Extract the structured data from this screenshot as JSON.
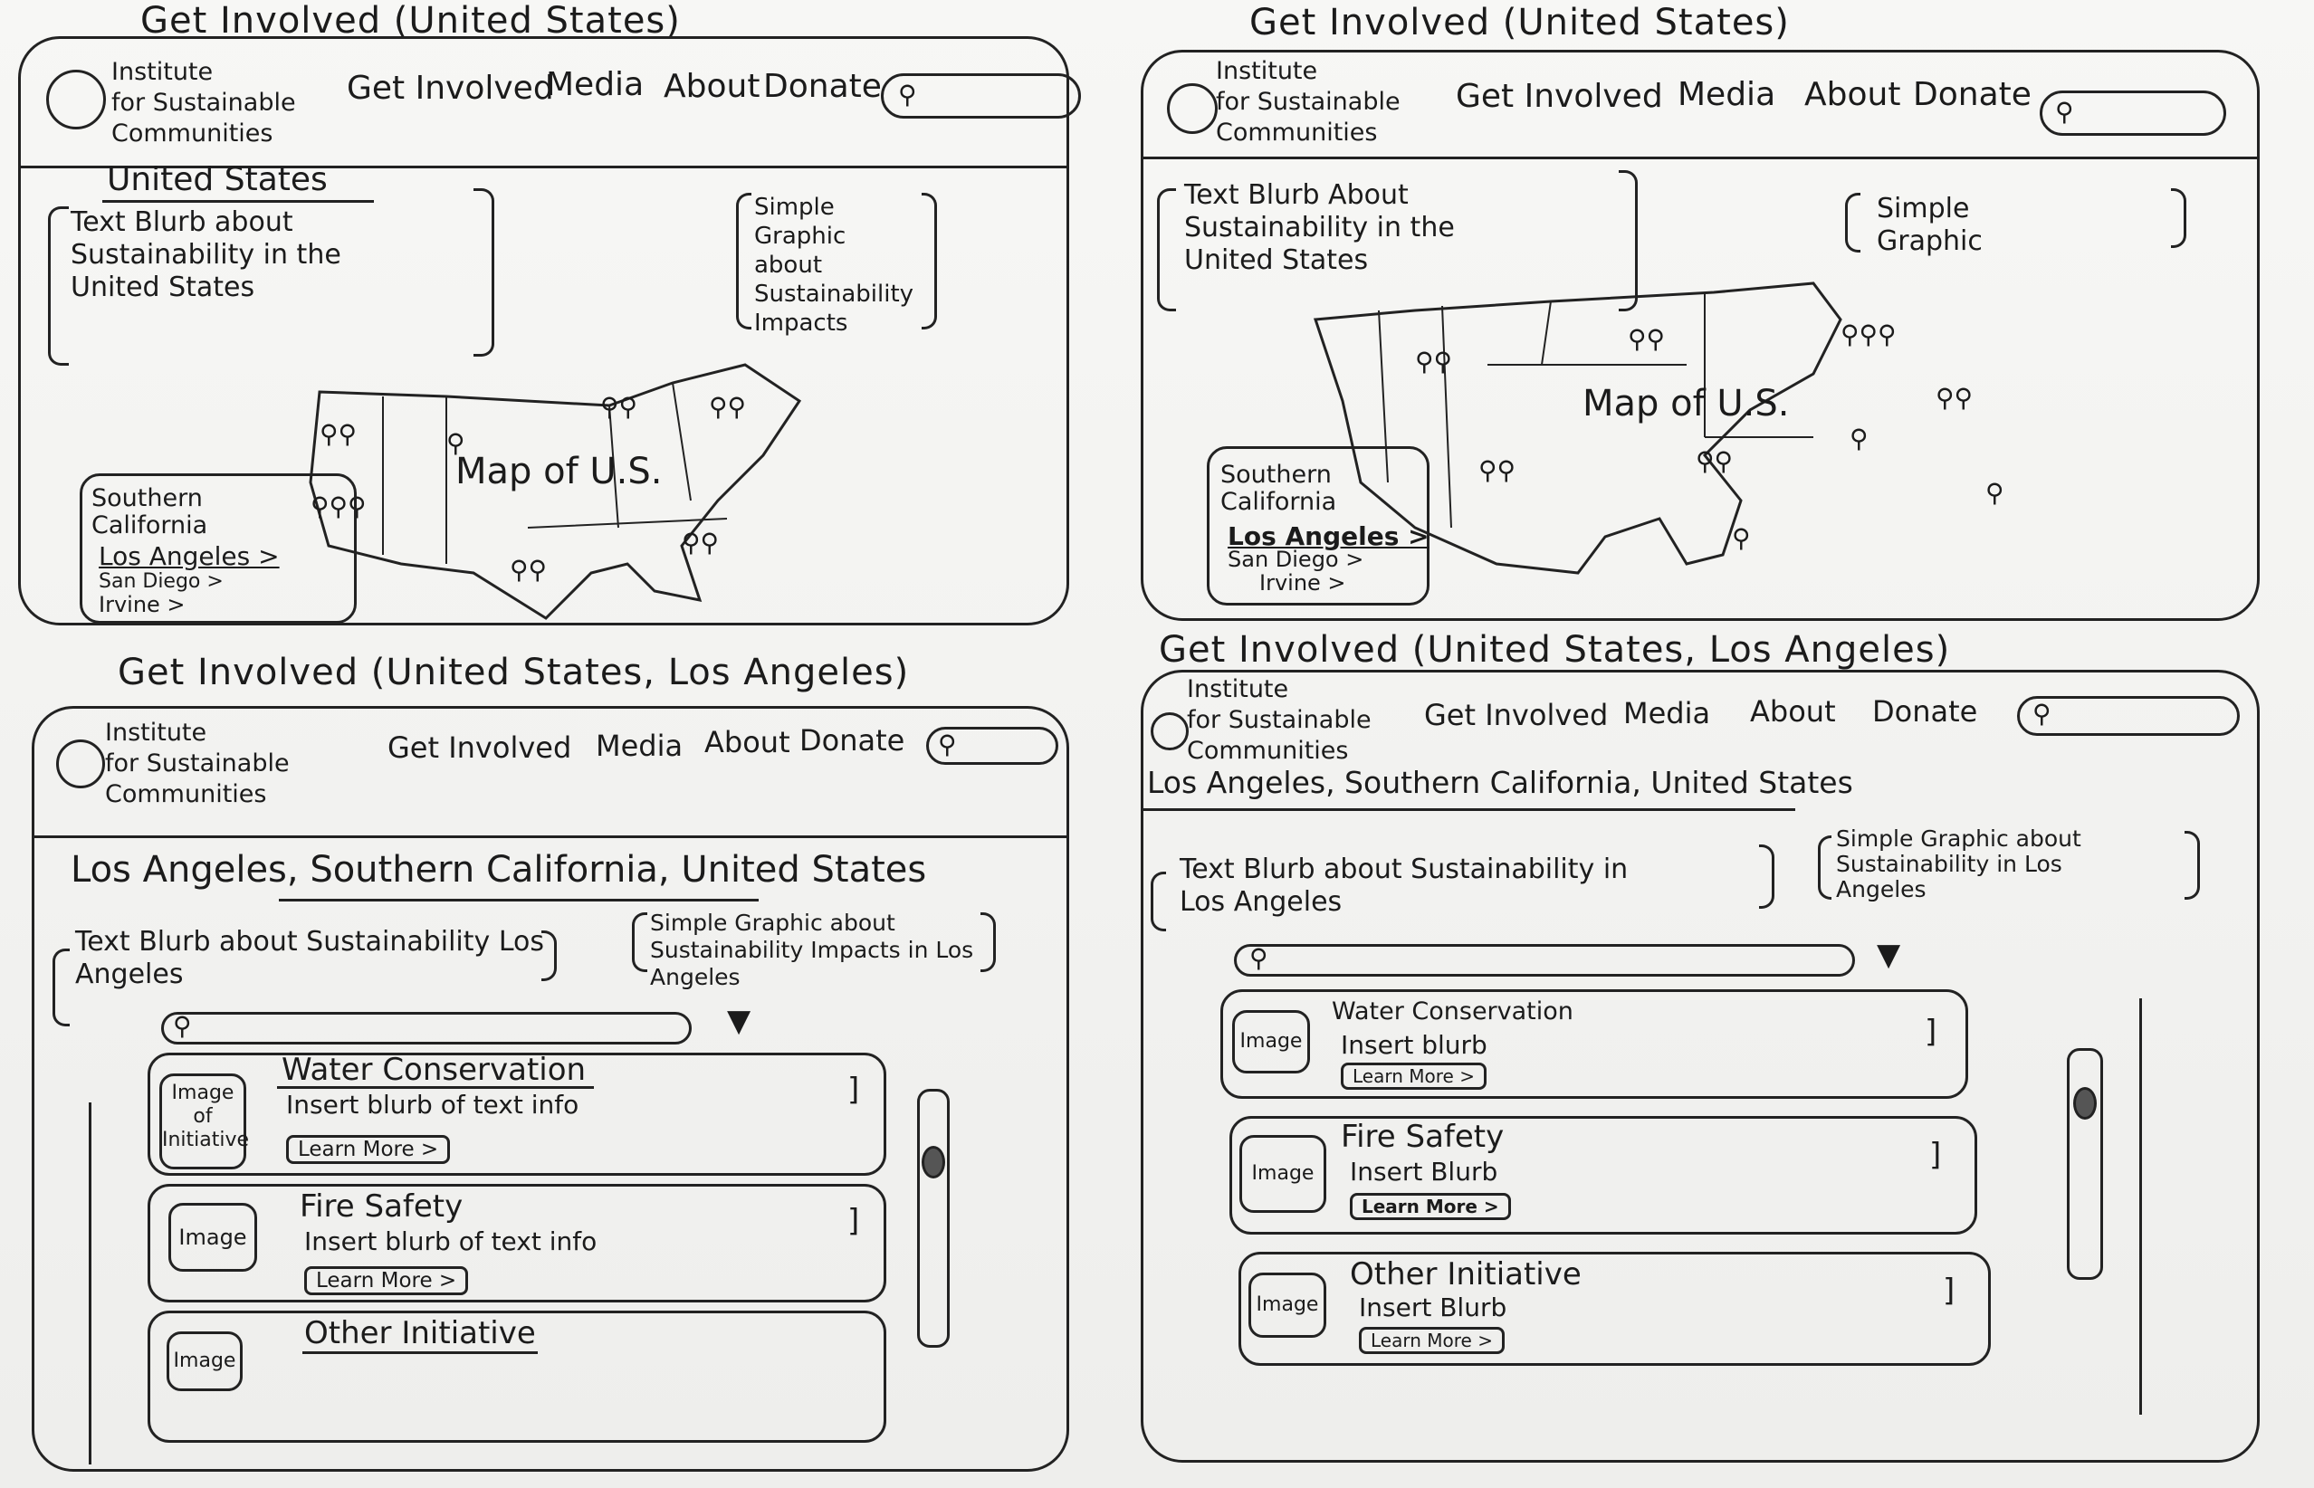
{
  "sketches": [
    {
      "title": "Get Involved (United States)",
      "org": [
        "Institute",
        "for Sustainable",
        "Communities"
      ],
      "nav": [
        "Get Involved",
        "Media",
        "About",
        "Donate"
      ],
      "heading": "United States",
      "blurb": "Text Blurb about Sustainability in the United States",
      "graphic": "Simple Graphic about Sustainability Impacts",
      "map_label": "Map of U.S.",
      "region_title": "Southern California",
      "region_links": [
        "Los Angeles >",
        "San Diego >",
        "Irvine >"
      ]
    },
    {
      "title": "Get Involved (United States)",
      "org": [
        "Institute",
        "for Sustainable",
        "Communities"
      ],
      "nav": [
        "Get Involved",
        "Media",
        "About",
        "Donate"
      ],
      "blurb": "Text Blurb About Sustainability in the United States",
      "graphic": "Simple Graphic",
      "map_label": "Map of U.S.",
      "region_title": "Southern California",
      "region_links": [
        "Los Angeles >",
        "San Diego >",
        "Irvine >"
      ]
    },
    {
      "title": "Get Involved (United States, Los Angeles)",
      "org": [
        "Institute",
        "for Sustainable",
        "Communities"
      ],
      "nav": [
        "Get Involved",
        "Media",
        "About",
        "Donate"
      ],
      "heading": "Los Angeles, Southern California, United States",
      "blurb": "Text Blurb about Sustainability Los Angeles",
      "graphic": "Simple Graphic about Sustainability Impacts in Los Angeles",
      "cards": [
        {
          "image": "Image of Initiative",
          "title": "Water Conservation",
          "blurb": "Insert blurb of text info",
          "learn": "Learn More >"
        },
        {
          "image": "Image",
          "title": "Fire Safety",
          "blurb": "Insert blurb of text info",
          "learn": "Learn More >"
        },
        {
          "image": "Image",
          "title": "Other Initiative",
          "blurb": "",
          "learn": ""
        }
      ]
    },
    {
      "title": "Get Involved (United States, Los Angeles)",
      "org": [
        "Institute",
        "for Sustainable",
        "Communities"
      ],
      "nav": [
        "Get Involved",
        "Media",
        "About",
        "Donate"
      ],
      "heading": "Los Angeles, Southern California, United States",
      "blurb": "Text Blurb about Sustainability in Los Angeles",
      "graphic": "Simple Graphic about Sustainability in Los Angeles",
      "cards": [
        {
          "image": "Image",
          "title": "Water Conservation",
          "blurb": "Insert blurb",
          "learn": "Learn More >"
        },
        {
          "image": "Image",
          "title": "Fire Safety",
          "blurb": "Insert Blurb",
          "learn": "Learn More >"
        },
        {
          "image": "Image",
          "title": "Other Initiative",
          "blurb": "Insert Blurb",
          "learn": "Learn More >"
        }
      ]
    }
  ],
  "icons": {
    "search": "search-icon",
    "logo": "globe-logo-icon",
    "pin": "map-pin-icon",
    "filter": "filter-icon"
  }
}
